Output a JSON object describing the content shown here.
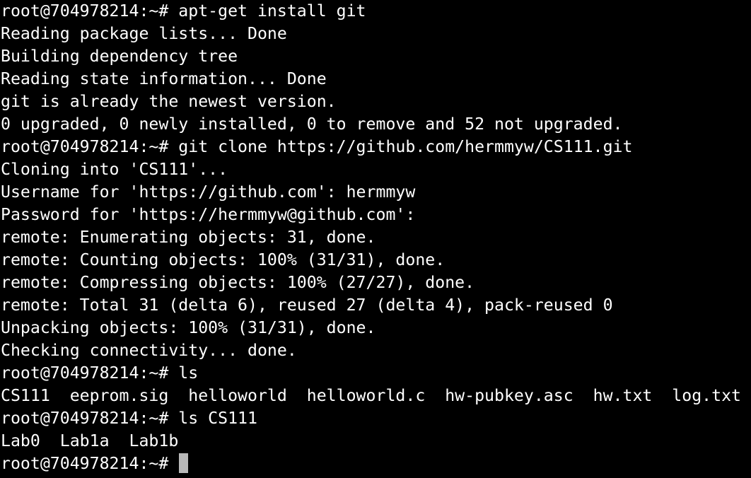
{
  "terminal": {
    "lines": [
      "root@704978214:~# apt-get install git",
      "Reading package lists... Done",
      "Building dependency tree",
      "Reading state information... Done",
      "git is already the newest version.",
      "0 upgraded, 0 newly installed, 0 to remove and 52 not upgraded.",
      "root@704978214:~# git clone https://github.com/hermmyw/CS111.git",
      "Cloning into 'CS111'...",
      "Username for 'https://github.com': hermmyw",
      "Password for 'https://hermmyw@github.com':",
      "remote: Enumerating objects: 31, done.",
      "remote: Counting objects: 100% (31/31), done.",
      "remote: Compressing objects: 100% (27/27), done.",
      "remote: Total 31 (delta 6), reused 27 (delta 4), pack-reused 0",
      "Unpacking objects: 100% (31/31), done.",
      "Checking connectivity... done.",
      "root@704978214:~# ls",
      "CS111  eeprom.sig  helloworld  helloworld.c  hw-pubkey.asc  hw.txt  log.txt",
      "root@704978214:~# ls CS111",
      "Lab0  Lab1a  Lab1b"
    ],
    "prompt": "root@704978214:~# ",
    "colors": {
      "background": "#000000",
      "foreground": "#ffffff",
      "cursor": "#b8b8b8"
    }
  }
}
